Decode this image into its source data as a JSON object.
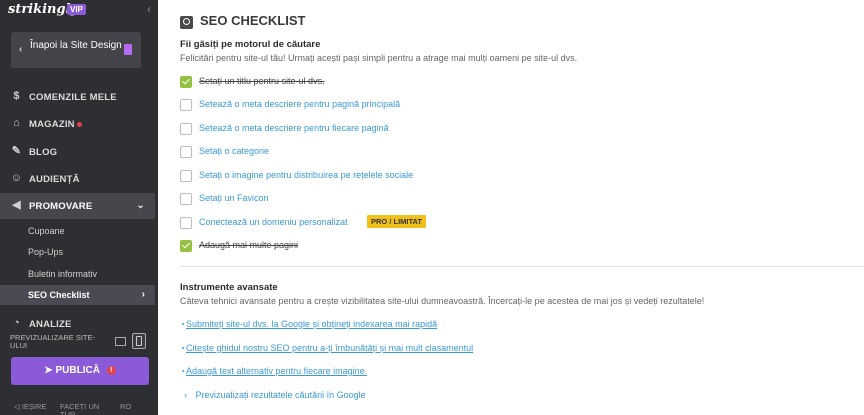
{
  "sidebar": {
    "brand": "strikingly",
    "vip": "VIP",
    "back_label": "Înapoi la Site Design",
    "nav": [
      {
        "label": "COMENZILE MELE",
        "icon": "dollar-icon"
      },
      {
        "label": "MAGAZIN",
        "icon": "store-icon",
        "dot": true
      },
      {
        "label": "BLOG",
        "icon": "pen-icon"
      },
      {
        "label": "AUDIENȚĂ",
        "icon": "users-icon"
      },
      {
        "label": "PROMOVARE",
        "icon": "megaphone-icon"
      }
    ],
    "sub": [
      "Cupoane",
      "Pop-Ups",
      "Buletin informativ",
      "SEO Checklist"
    ],
    "partial_item": "ANALIZE",
    "preview_label": "PREVIZUALIZARE SITE-ULUI",
    "publish_label": "PUBLICĂ",
    "footer": [
      "IEȘIRE",
      "FACEȚI UN TUR",
      "RO"
    ]
  },
  "main": {
    "title": "SEO CHECKLIST",
    "section1": {
      "heading": "Fii găsiți pe motorul de căutare",
      "desc": "Felicitări pentru site-ul tău! Urmați acești pași simpli pentru a atrage mai mulți oameni pe site-ul dvs.",
      "items": [
        {
          "label": "Setați un titlu pentru site-ul dvs.",
          "done": true
        },
        {
          "label": "Setează o meta descriere pentru pagină principală",
          "done": false
        },
        {
          "label": "Setează o meta descriere pentru fiecare pagină",
          "done": false
        },
        {
          "label": "Setați o categorie",
          "done": false
        },
        {
          "label": "Setați o imagine pentru distribuirea pe rețelele sociale",
          "done": false
        },
        {
          "label": "Setați un Favicon",
          "done": false
        },
        {
          "label": "Conectează un domeniu personalizat",
          "done": false,
          "badge": "PRO / LIMITAT"
        },
        {
          "label": "Adaugă mai multe pagini",
          "done": true
        }
      ]
    },
    "section2": {
      "heading": "Instrumente avansate",
      "desc": "Câteva tehnici avansate pentru a crește vizibilitatea site-ului dumneavoastră. Încercați-le pe acestea de mai jos și vedeți rezultatele!",
      "links": [
        "Submiteți site-ul dvs. la Google și obțineți indexarea mai rapidă",
        "Citește ghidul nostru SEO pentru a-ți îmbunătăți și mai mult clasamentul",
        "Adaugă text alternativ pentru fiecare imagine."
      ],
      "preview_link": "Previzualizați rezultatele căutării în Google"
    }
  }
}
